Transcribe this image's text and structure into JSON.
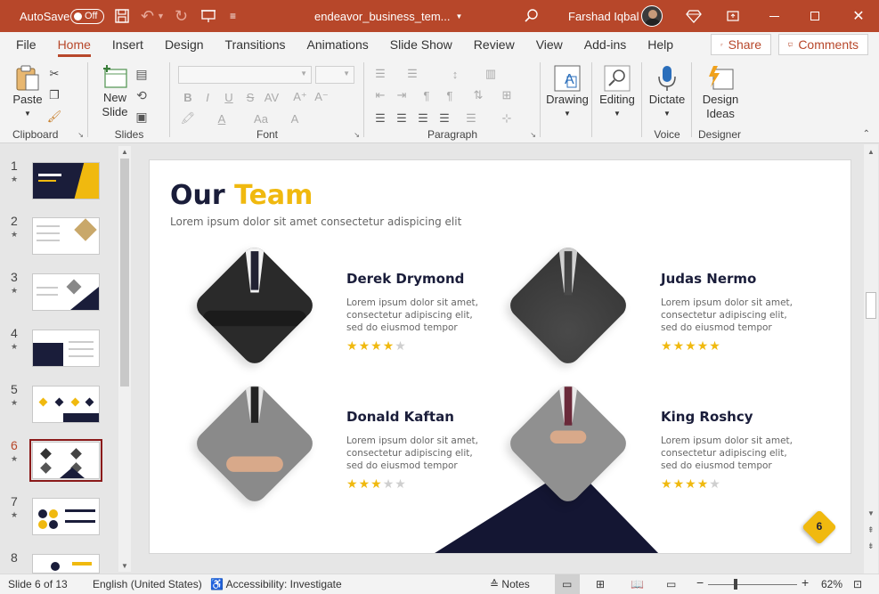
{
  "titlebar": {
    "autosave_label": "AutoSave",
    "autosave_state": "Off",
    "filename": "endeavor_business_tem...",
    "user": "Farshad Iqbal"
  },
  "menu": {
    "items": [
      "File",
      "Home",
      "Insert",
      "Design",
      "Transitions",
      "Animations",
      "Slide Show",
      "Review",
      "View",
      "Add-ins",
      "Help"
    ],
    "active": "Home",
    "share": "Share",
    "comments": "Comments"
  },
  "ribbon": {
    "clipboard": {
      "label": "Clipboard",
      "paste": "Paste"
    },
    "slides": {
      "label": "Slides",
      "new_slide": "New Slide"
    },
    "font": {
      "label": "Font"
    },
    "paragraph": {
      "label": "Paragraph"
    },
    "drawing": {
      "label": "Drawing"
    },
    "editing": {
      "label": "Editing"
    },
    "voice": {
      "label": "Voice",
      "dictate": "Dictate"
    },
    "designer": {
      "label": "Designer",
      "design_ideas": "Design Ideas"
    }
  },
  "thumbnails": {
    "numbers": [
      "1",
      "2",
      "3",
      "4",
      "5",
      "6",
      "7",
      "8"
    ],
    "selected": "6"
  },
  "slide": {
    "title_part1": "Our ",
    "title_part2": "Team",
    "subtitle": "Lorem ipsum dolor sit amet consectetur adispicing elit",
    "badge": "6",
    "people": [
      {
        "name": "Derek Drymond",
        "desc": [
          "Lorem ipsum dolor sit amet,",
          "consectetur adipiscing elit,",
          "sed do eiusmod tempor"
        ],
        "rating": 4
      },
      {
        "name": "Judas Nermo",
        "desc": [
          "Lorem ipsum dolor sit amet,",
          "consectetur adipiscing elit,",
          "sed do eiusmod tempor"
        ],
        "rating": 5
      },
      {
        "name": "Donald Kaftan",
        "desc": [
          "Lorem ipsum dolor sit amet,",
          "consectetur adipiscing elit,",
          "sed do eiusmod tempor"
        ],
        "rating": 3
      },
      {
        "name": "King Roshcy",
        "desc": [
          "Lorem ipsum dolor sit amet,",
          "consectetur adipiscing elit,",
          "sed do eiusmod tempor"
        ],
        "rating": 4
      }
    ]
  },
  "statusbar": {
    "slide_info": "Slide 6 of 13",
    "language": "English (United States)",
    "accessibility": "Accessibility: Investigate",
    "notes": "Notes",
    "zoom": "62%"
  },
  "colors": {
    "accent": "#b7472a",
    "navy": "#1a1d3a",
    "gold": "#f0b90f"
  }
}
